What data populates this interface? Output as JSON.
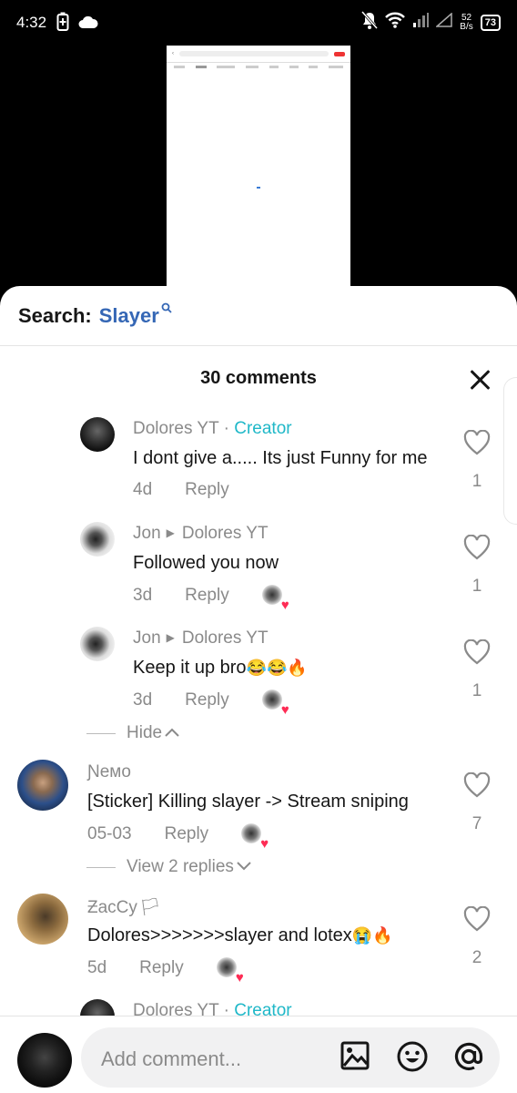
{
  "status_bar": {
    "time": "4:32",
    "speed_value": "52",
    "speed_unit": "B/s",
    "battery": "73",
    "icons": [
      "battery-charging-icon",
      "cloud-icon",
      "mute-bell-icon",
      "wifi-icon",
      "signal-icon",
      "signal-empty-icon"
    ]
  },
  "search": {
    "label": "Search:",
    "term": "Slayer",
    "icon": "search-icon"
  },
  "panel": {
    "title": "30 comments",
    "close_icon": "close-icon"
  },
  "comments": [
    {
      "author": "Dolores YT",
      "separator": " · ",
      "badge": "Creator",
      "text": "I dont give a..... Its just Funny for me",
      "time": "4d",
      "reply": "Reply",
      "likes": "1"
    },
    {
      "author": "Jon",
      "reply_to": "Dolores YT",
      "text": "Followed you now",
      "time": "3d",
      "reply": "Reply",
      "likes": "1"
    },
    {
      "author": "Jon",
      "reply_to": "Dolores YT",
      "text": "Keep it up bro",
      "emojis": "😂😂🔥",
      "time": "3d",
      "reply": "Reply",
      "likes": "1"
    },
    {
      "author": "Ɲемо",
      "text": "[Sticker] Killing slayer -> Stream sniping",
      "time": "05-03",
      "reply": "Reply",
      "likes": "7"
    },
    {
      "author": "ƵacϹу",
      "flag": "🏳",
      "text": "Dolores>>>>>>>slayer and lotex",
      "emojis": "😭🔥",
      "time": "5d",
      "reply": "Reply",
      "likes": "2"
    },
    {
      "author": "Dolores YT",
      "separator": " · ",
      "badge": "Creator"
    }
  ],
  "toggles": {
    "hide": "Hide",
    "view_replies": "View 2 replies"
  },
  "composer": {
    "placeholder": "Add comment...",
    "icons": [
      "image-icon",
      "emoji-icon",
      "mention-icon"
    ]
  },
  "colors": {
    "accent_blue": "#3567b5",
    "creator_teal": "#20b8c8",
    "heart_red": "#fe2c55",
    "muted_text": "#8a8a8a"
  }
}
